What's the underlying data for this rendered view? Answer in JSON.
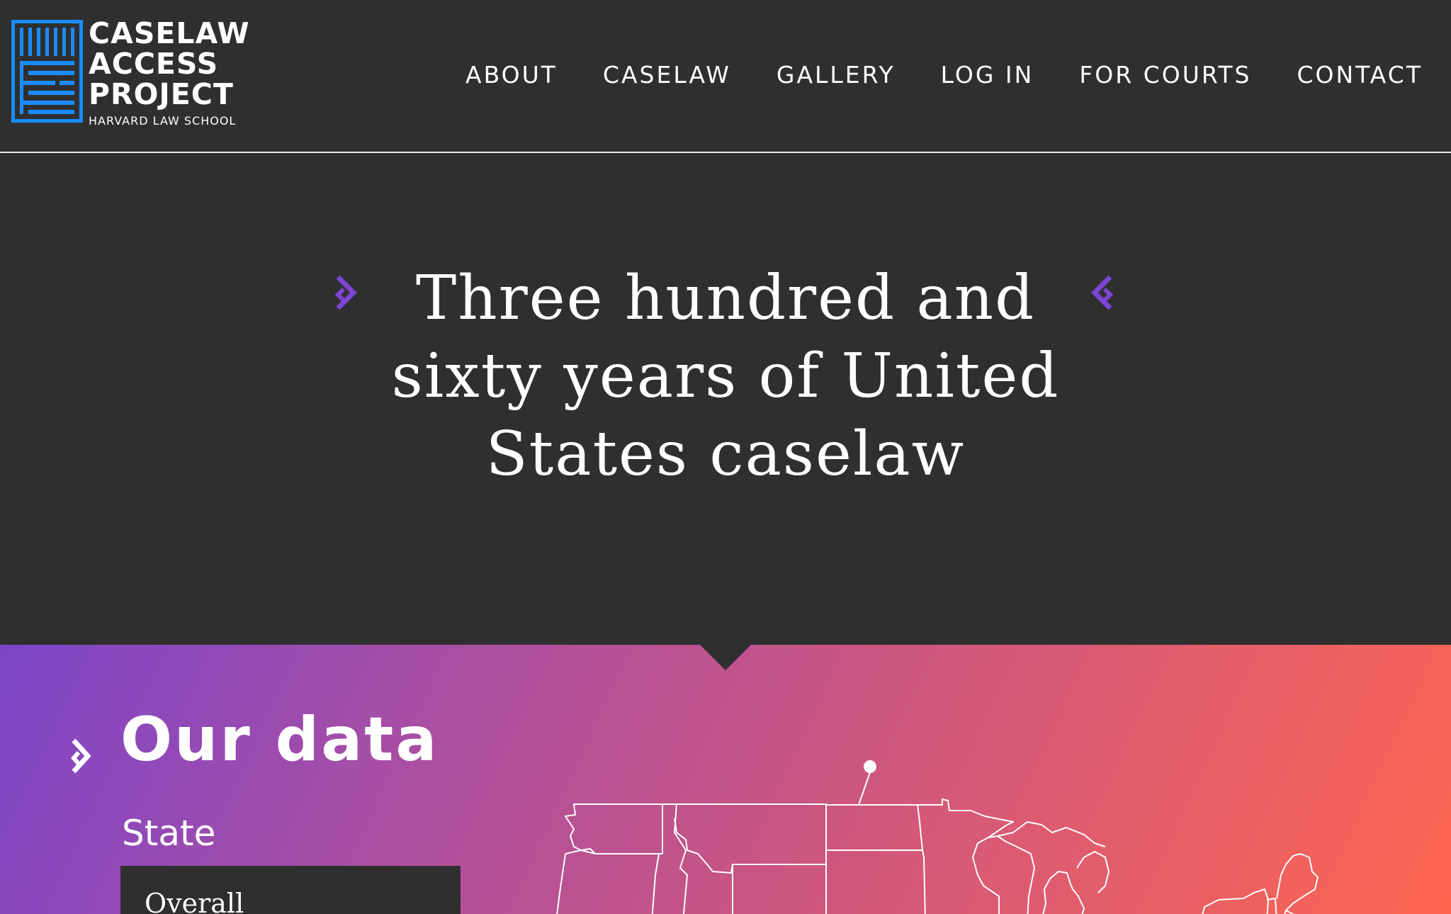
{
  "header": {
    "logo": {
      "lines": [
        "CASELAW",
        "ACCESS",
        "PROJECT"
      ],
      "subtitle": "HARVARD LAW SCHOOL",
      "icon": "caselaw-logo-icon",
      "color": "#1a8cff"
    },
    "nav": [
      {
        "label": "ABOUT"
      },
      {
        "label": "CASELAW"
      },
      {
        "label": "GALLERY"
      },
      {
        "label": "LOG IN"
      },
      {
        "label": "FOR COURTS"
      },
      {
        "label": "CONTACT"
      }
    ]
  },
  "hero": {
    "title": "Three hundred and sixty years of United States caselaw",
    "bracket_icon": "bracket-icon",
    "accent_color": "#7d44d6"
  },
  "data_section": {
    "title": "Our data",
    "state_label": "State",
    "state_select_value": "Overall",
    "map_icon": "us-map-icon",
    "gradient": [
      "#7c45c8",
      "#ff6650"
    ]
  },
  "colors": {
    "background": "#2f2f2f",
    "text": "#ffffff"
  }
}
